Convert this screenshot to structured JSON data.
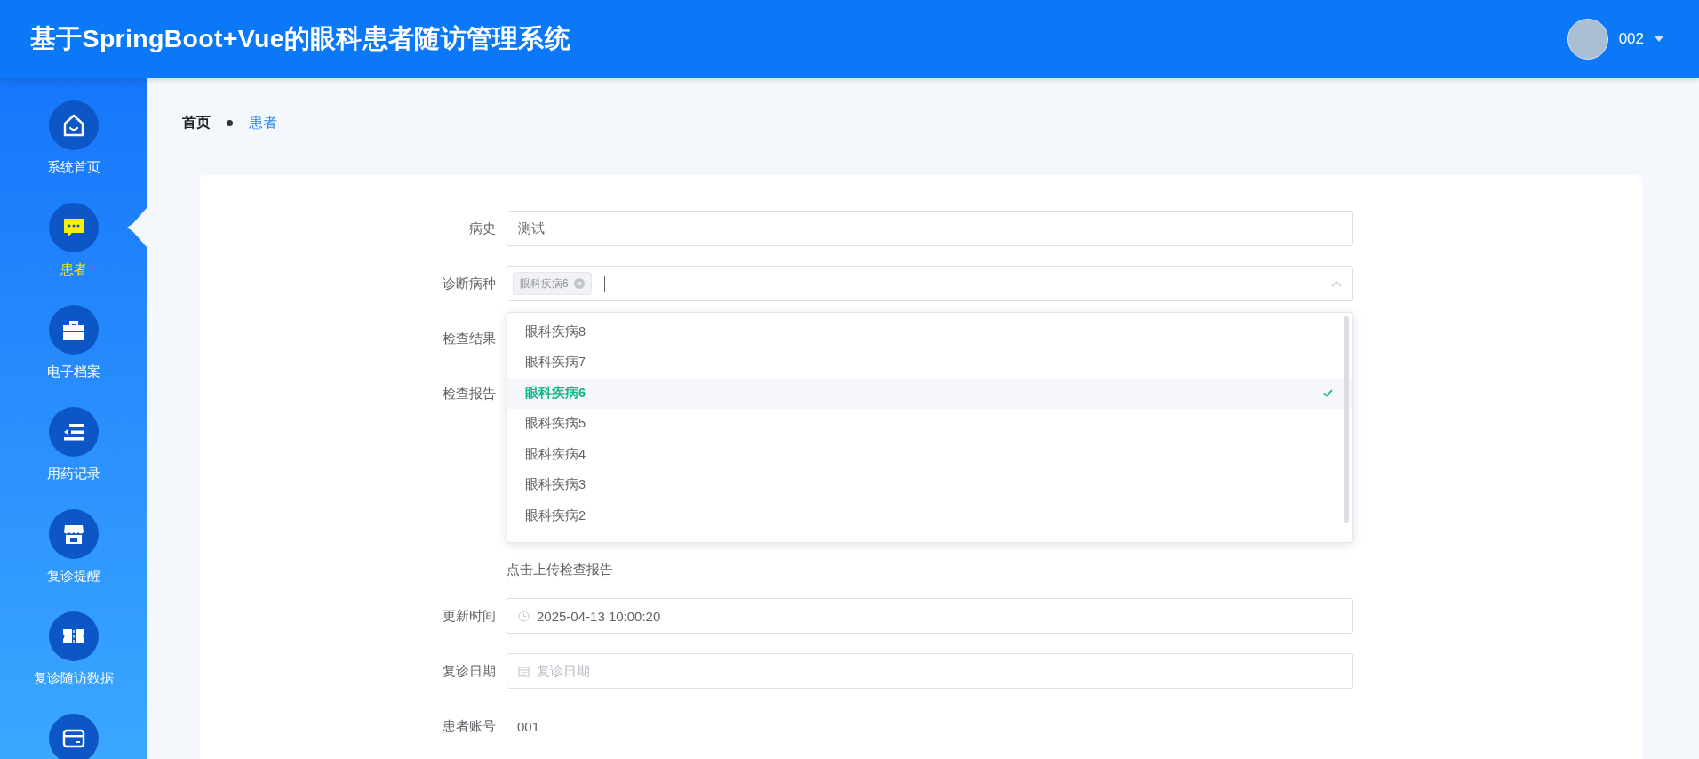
{
  "header": {
    "title": "基于SpringBoot+Vue的眼科患者随访管理系统",
    "user": {
      "name": "002"
    }
  },
  "sidebar": {
    "items": [
      {
        "label": "系统首页",
        "kind": "home",
        "selected": false
      },
      {
        "label": "患者",
        "kind": "chat",
        "selected": true
      },
      {
        "label": "电子档案",
        "kind": "briefcase",
        "selected": false
      },
      {
        "label": "用药记录",
        "kind": "list",
        "selected": false
      },
      {
        "label": "复诊提醒",
        "kind": "shop",
        "selected": false
      },
      {
        "label": "复诊随访数据",
        "kind": "ticket",
        "selected": false
      },
      {
        "kind": "card",
        "selected": false
      }
    ]
  },
  "breadcrumb": [
    {
      "text": "首页",
      "current": false
    },
    {
      "text": "患者",
      "current": true
    }
  ],
  "form": {
    "fields": [
      {
        "kind": "text",
        "label": "病史",
        "value": "测试"
      },
      {
        "kind": "select",
        "label": "诊断病种",
        "tags": [
          "眼科疾病6"
        ]
      },
      {
        "kind": "covered",
        "label": "检查结果"
      },
      {
        "kind": "upload",
        "label": "检查报告",
        "hint": "点击上传检查报告"
      },
      {
        "kind": "datetime",
        "label": "更新时间",
        "value": "2025-04-13 10:00:20"
      },
      {
        "kind": "date",
        "label": "复诊日期",
        "placeholder": "复诊日期"
      },
      {
        "kind": "static",
        "label": "患者账号",
        "value": "001"
      }
    ]
  },
  "dropdown": {
    "options": [
      {
        "label": "眼科疾病8",
        "selected": false
      },
      {
        "label": "眼科疾病7",
        "selected": false
      },
      {
        "label": "眼科疾病6",
        "selected": true
      },
      {
        "label": "眼科疾病5",
        "selected": false
      },
      {
        "label": "眼科疾病4",
        "selected": false
      },
      {
        "label": "眼科疾病3",
        "selected": false
      },
      {
        "label": "眼科疾病2",
        "selected": false
      }
    ]
  }
}
